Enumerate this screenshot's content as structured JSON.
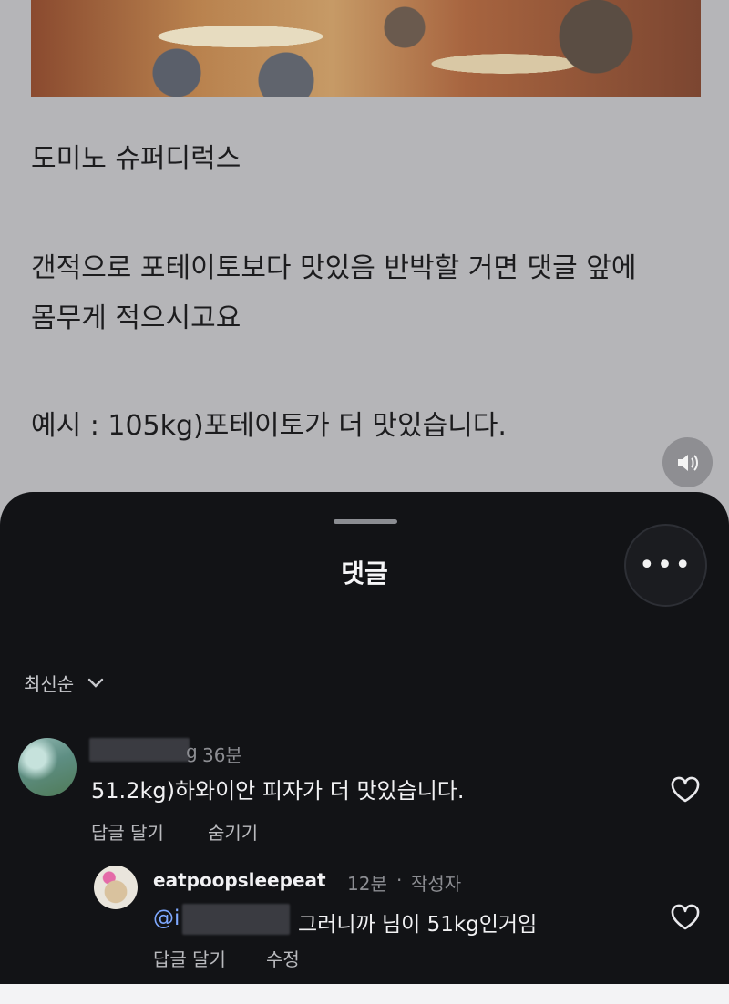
{
  "post": {
    "title_line": "도미노 슈퍼디럭스",
    "body_line1": "갠적으로 포테이토보다 맛있음 반박할 거면 댓글 앞에",
    "body_line2": "몸무게 적으시고요",
    "example_line": "예시 : 105kg)포테이토가 더 맛있습니다."
  },
  "sheet": {
    "title": "댓글",
    "more_icon": "ellipsis-icon",
    "sort_label": "최신순"
  },
  "comments": [
    {
      "username_tail": "g",
      "time": "36분",
      "text": "51.2kg)하와이안 피자가 더 맛있습니다.",
      "actions": [
        "답글 달기",
        "숨기기"
      ]
    },
    {
      "username": "eatpoopsleepeat",
      "time": "12분",
      "separator": "·",
      "author_badge": "작성자",
      "mention_prefix": "@i",
      "text": "그러니까 님이 51kg인거임",
      "actions": [
        "답글 달기",
        "수정"
      ]
    }
  ],
  "icons": {
    "sound": "speaker-icon",
    "like": "heart-icon",
    "sort": "chevron-down-icon"
  }
}
